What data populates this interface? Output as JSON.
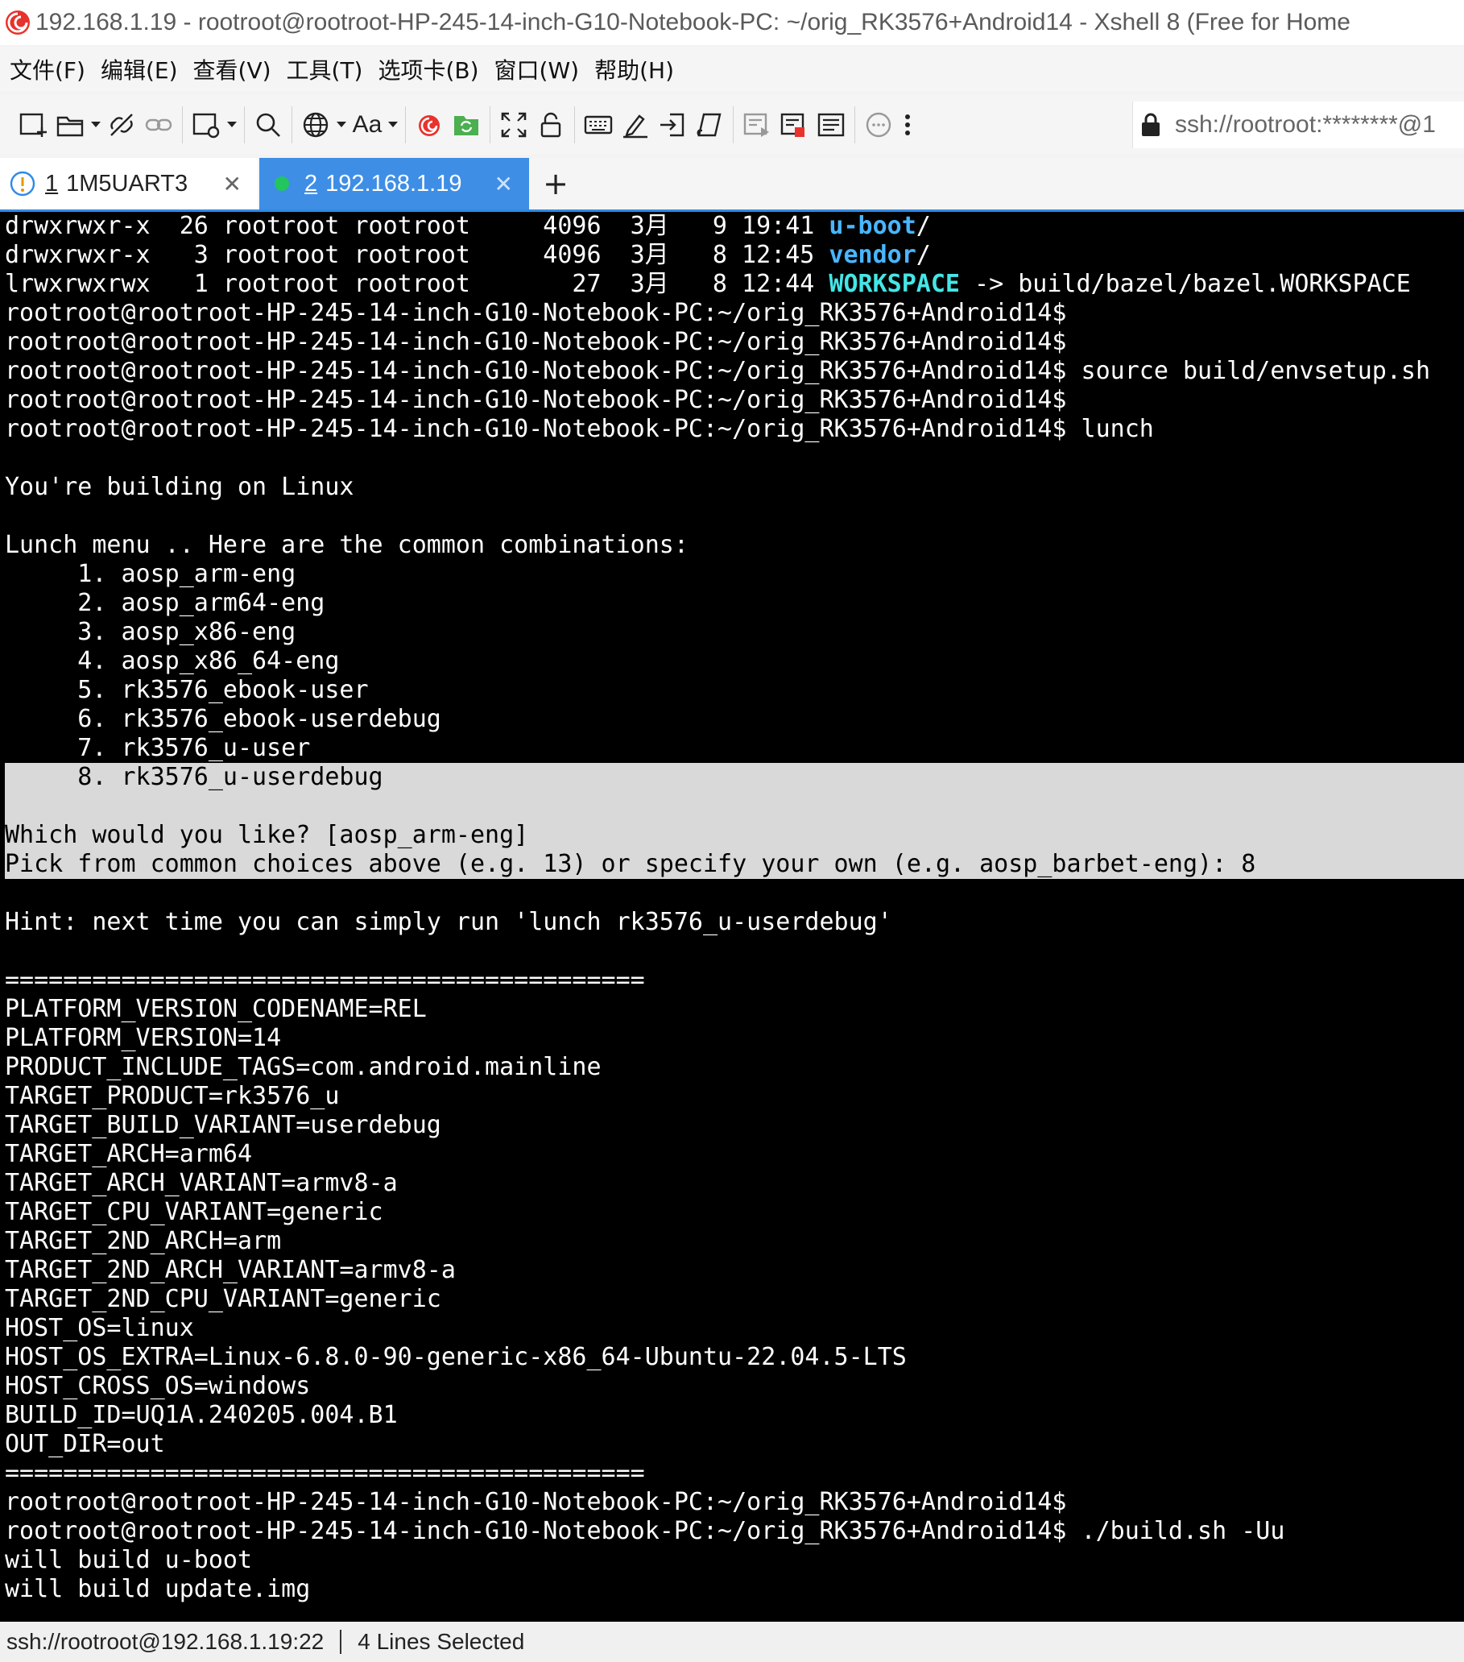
{
  "window": {
    "title": "192.168.1.19 - rootroot@rootroot-HP-245-14-inch-G10-Notebook-PC: ~/orig_RK3576+Android14 - Xshell 8 (Free for Home"
  },
  "menu": [
    {
      "label": "文件(F)"
    },
    {
      "label": "编辑(E)"
    },
    {
      "label": "查看(V)"
    },
    {
      "label": "工具(T)"
    },
    {
      "label": "选项卡(B)"
    },
    {
      "label": "窗口(W)"
    },
    {
      "label": "帮助(H)"
    }
  ],
  "toolbar": {
    "font_button_label": "Aa",
    "address": "ssh://rootroot:********@1"
  },
  "tabs": [
    {
      "number": "1",
      "title": "1M5UART3",
      "close": "✕"
    },
    {
      "number": "2",
      "title": "192.168.1.19",
      "close": "✕"
    }
  ],
  "tab_add_label": "+",
  "terminal": {
    "lines": [
      "drwxrwxr-x  26 rootroot rootroot     4096  3月   9 19:41 u-boot/",
      "drwxrwxr-x   3 rootroot rootroot     4096  3月   8 12:45 vendor/",
      "lrwxrwxrwx   1 rootroot rootroot       27  3月   8 12:44 WORKSPACE -> build/bazel/bazel.WORKSPACE",
      "rootroot@rootroot-HP-245-14-inch-G10-Notebook-PC:~/orig_RK3576+Android14$",
      "rootroot@rootroot-HP-245-14-inch-G10-Notebook-PC:~/orig_RK3576+Android14$",
      "rootroot@rootroot-HP-245-14-inch-G10-Notebook-PC:~/orig_RK3576+Android14$ source build/envsetup.sh",
      "rootroot@rootroot-HP-245-14-inch-G10-Notebook-PC:~/orig_RK3576+Android14$",
      "rootroot@rootroot-HP-245-14-inch-G10-Notebook-PC:~/orig_RK3576+Android14$ lunch",
      "",
      "You're building on Linux",
      "",
      "Lunch menu .. Here are the common combinations:",
      "     1. aosp_arm-eng",
      "     2. aosp_arm64-eng",
      "     3. aosp_x86-eng",
      "     4. aosp_x86_64-eng",
      "     5. rk3576_ebook-user",
      "     6. rk3576_ebook-userdebug",
      "     7. rk3576_u-user",
      "     8. rk3576_u-userdebug",
      "",
      "Which would you like? [aosp_arm-eng]",
      "Pick from common choices above (e.g. 13) or specify your own (e.g. aosp_barbet-eng): 8",
      "",
      "Hint: next time you can simply run 'lunch rk3576_u-userdebug'",
      "",
      "============================================",
      "PLATFORM_VERSION_CODENAME=REL",
      "PLATFORM_VERSION=14",
      "PRODUCT_INCLUDE_TAGS=com.android.mainline",
      "TARGET_PRODUCT=rk3576_u",
      "TARGET_BUILD_VARIANT=userdebug",
      "TARGET_ARCH=arm64",
      "TARGET_ARCH_VARIANT=armv8-a",
      "TARGET_CPU_VARIANT=generic",
      "TARGET_2ND_ARCH=arm",
      "TARGET_2ND_ARCH_VARIANT=armv8-a",
      "TARGET_2ND_CPU_VARIANT=generic",
      "HOST_OS=linux",
      "HOST_OS_EXTRA=Linux-6.8.0-90-generic-x86_64-Ubuntu-22.04.5-LTS",
      "HOST_CROSS_OS=windows",
      "BUILD_ID=UQ1A.240205.004.B1",
      "OUT_DIR=out",
      "============================================",
      "rootroot@rootroot-HP-245-14-inch-G10-Notebook-PC:~/orig_RK3576+Android14$",
      "rootroot@rootroot-HP-245-14-inch-G10-Notebook-PC:~/orig_RK3576+Android14$ ./build.sh -Uu",
      "will build u-boot",
      "will build update.img"
    ],
    "selected_lines": [
      19,
      20,
      21,
      22
    ],
    "colors": {
      "directory": "#49b6ff",
      "symlink": "#44e6e6",
      "selection": "#d9d9d9"
    }
  },
  "status": {
    "connection": "ssh://rootroot@192.168.1.19:22",
    "selection": "4 Lines Selected"
  },
  "icons": [
    "new-session-icon",
    "open-folder-icon",
    "disconnect-icon",
    "reconnect-link-icon",
    "new-tab-icon",
    "search-icon",
    "globe-icon",
    "font-icon",
    "xshell-icon",
    "xftp-icon",
    "fullscreen-icon",
    "lock-icon",
    "keyboard-icon",
    "highlight-icon",
    "send-icon",
    "script-icon",
    "compose-icon",
    "log-icon",
    "transfer-icon",
    "chat-icon",
    "more-icon"
  ]
}
